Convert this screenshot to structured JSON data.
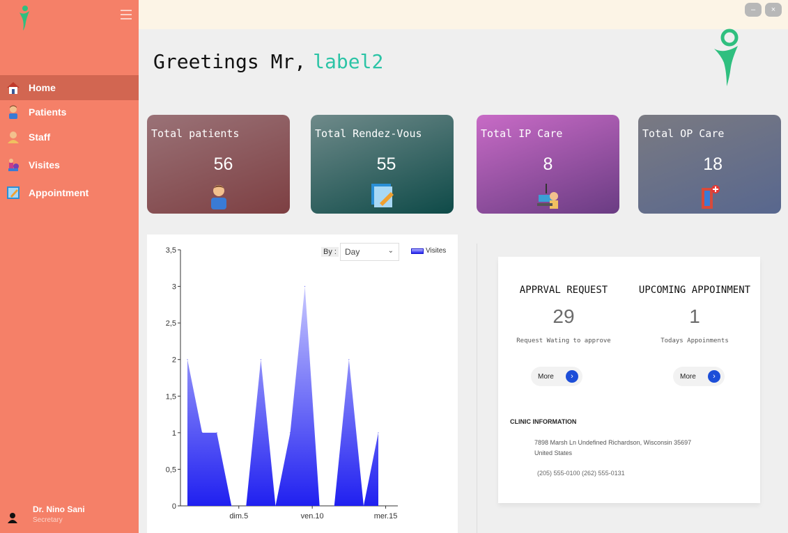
{
  "sidebar": {
    "items": [
      {
        "label": "Home",
        "icon": "home-icon"
      },
      {
        "label": "Patients",
        "icon": "patient-icon"
      },
      {
        "label": "Staff",
        "icon": "staff-icon"
      },
      {
        "label": "Visites",
        "icon": "visits-icon"
      },
      {
        "label": "Appointment",
        "icon": "appointment-icon"
      }
    ],
    "profile": {
      "name": "Dr. Nino Sani",
      "role": "Secretary"
    }
  },
  "window": {
    "minimize": "–",
    "close": "×"
  },
  "greeting": {
    "text": "Greetings Mr,",
    "name": "label2"
  },
  "cards": [
    {
      "title": "Total patients",
      "value": "56"
    },
    {
      "title": "Total Rendez-Vous",
      "value": "55"
    },
    {
      "title": "Total IP Care",
      "value": "8"
    },
    {
      "title": "Total OP Care",
      "value": "18"
    }
  ],
  "chart_controls": {
    "by_label": "By :",
    "selected": "Day",
    "legend": "Visites"
  },
  "chart_data": {
    "type": "area",
    "series": [
      {
        "name": "Visites",
        "values": [
          2,
          1,
          1,
          0,
          0,
          2,
          0,
          1,
          3,
          0,
          0,
          2,
          0,
          1
        ]
      }
    ],
    "x_tick_labels": [
      {
        "index": 3.5,
        "label": "dim.5"
      },
      {
        "index": 8.5,
        "label": "ven.10"
      },
      {
        "index": 13.5,
        "label": "mer.15"
      }
    ],
    "ylim": [
      0,
      3.5
    ],
    "y_ticks": [
      "0",
      "0,5",
      "1",
      "1,5",
      "2",
      "2,5",
      "3",
      "3,5"
    ],
    "color": "#2020f0"
  },
  "info": {
    "approval": {
      "title": "APPRVAL REQUEST",
      "value": "29",
      "sub": "Request Wating to approve",
      "more": "More"
    },
    "upcoming": {
      "title": "UPCOMING APPOINMENT",
      "value": "1",
      "sub": "Todays Appoinments",
      "more": "More"
    },
    "clinic_title": "CLINIC INFORMATION",
    "address_line1": "7898 Marsh Ln Undefined Richardson, Wisconsin 35697",
    "address_line2": "United States",
    "phones": "(205) 555-0100 (262) 555-0131"
  }
}
